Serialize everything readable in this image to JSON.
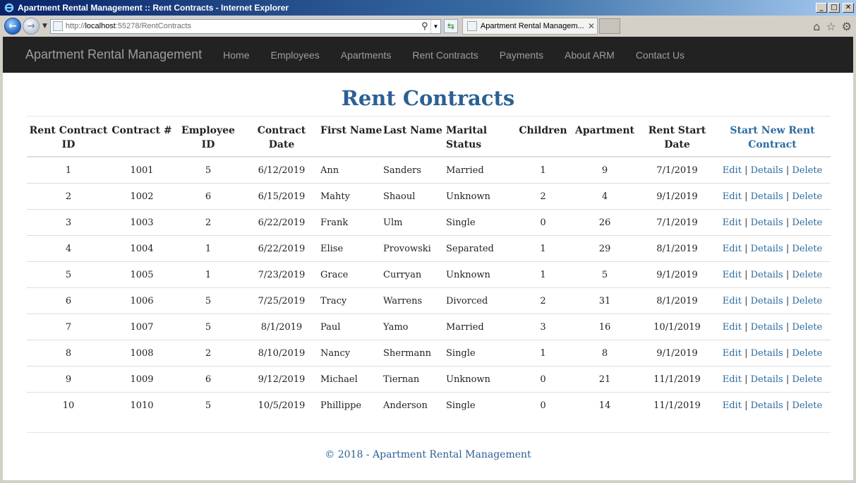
{
  "window": {
    "title": "Apartment Rental Management :: Rent Contracts - Internet Explorer",
    "minimize": "_",
    "maximize": "□",
    "close": "✕"
  },
  "addressbar": {
    "url_prefix": "http://",
    "url_host": "localhost",
    "url_rest": ":55278/RentContracts",
    "tab_title": "Apartment Rental Managem..."
  },
  "navbar": {
    "brand": "Apartment Rental Management",
    "links": [
      "Home",
      "Employees",
      "Apartments",
      "Rent Contracts",
      "Payments",
      "About ARM",
      "Contact Us"
    ]
  },
  "main": {
    "title": "Rent Contracts",
    "columns": {
      "id": "Rent Contract ID",
      "number": "Contract #",
      "employee": "Employee ID",
      "date": "Contract Date",
      "first": "First Name",
      "last": "Last Name",
      "marital": "Marital Status",
      "children": "Children",
      "apartment": "Apartment",
      "start": "Rent Start Date",
      "new_link": "Start New Rent Contract"
    },
    "actions": {
      "edit": "Edit",
      "details": "Details",
      "delete": "Delete",
      "separator": "|"
    },
    "rows": [
      [
        "1",
        "1001",
        "5",
        "6/12/2019",
        "Ann",
        "Sanders",
        "Married",
        "1",
        "9",
        "7/1/2019"
      ],
      [
        "2",
        "1002",
        "6",
        "6/15/2019",
        "Mahty",
        "Shaoul",
        "Unknown",
        "2",
        "4",
        "9/1/2019"
      ],
      [
        "3",
        "1003",
        "2",
        "6/22/2019",
        "Frank",
        "Ulm",
        "Single",
        "0",
        "26",
        "7/1/2019"
      ],
      [
        "4",
        "1004",
        "1",
        "6/22/2019",
        "Elise",
        "Provowski",
        "Separated",
        "1",
        "29",
        "8/1/2019"
      ],
      [
        "5",
        "1005",
        "1",
        "7/23/2019",
        "Grace",
        "Curryan",
        "Unknown",
        "1",
        "5",
        "9/1/2019"
      ],
      [
        "6",
        "1006",
        "5",
        "7/25/2019",
        "Tracy",
        "Warrens",
        "Divorced",
        "2",
        "31",
        "8/1/2019"
      ],
      [
        "7",
        "1007",
        "5",
        "8/1/2019",
        "Paul",
        "Yamo",
        "Married",
        "3",
        "16",
        "10/1/2019"
      ],
      [
        "8",
        "1008",
        "2",
        "8/10/2019",
        "Nancy",
        "Shermann",
        "Single",
        "1",
        "8",
        "9/1/2019"
      ],
      [
        "9",
        "1009",
        "6",
        "9/12/2019",
        "Michael",
        "Tiernan",
        "Unknown",
        "0",
        "21",
        "11/1/2019"
      ],
      [
        "10",
        "1010",
        "5",
        "10/5/2019",
        "Phillippe",
        "Anderson",
        "Single",
        "0",
        "14",
        "11/1/2019"
      ]
    ]
  },
  "footer": {
    "text": "© 2018 - Apartment Rental Management"
  },
  "colors": {
    "title_blue": "#2b6094",
    "link_blue": "#2b6a9e",
    "navbar_bg": "#222222"
  }
}
